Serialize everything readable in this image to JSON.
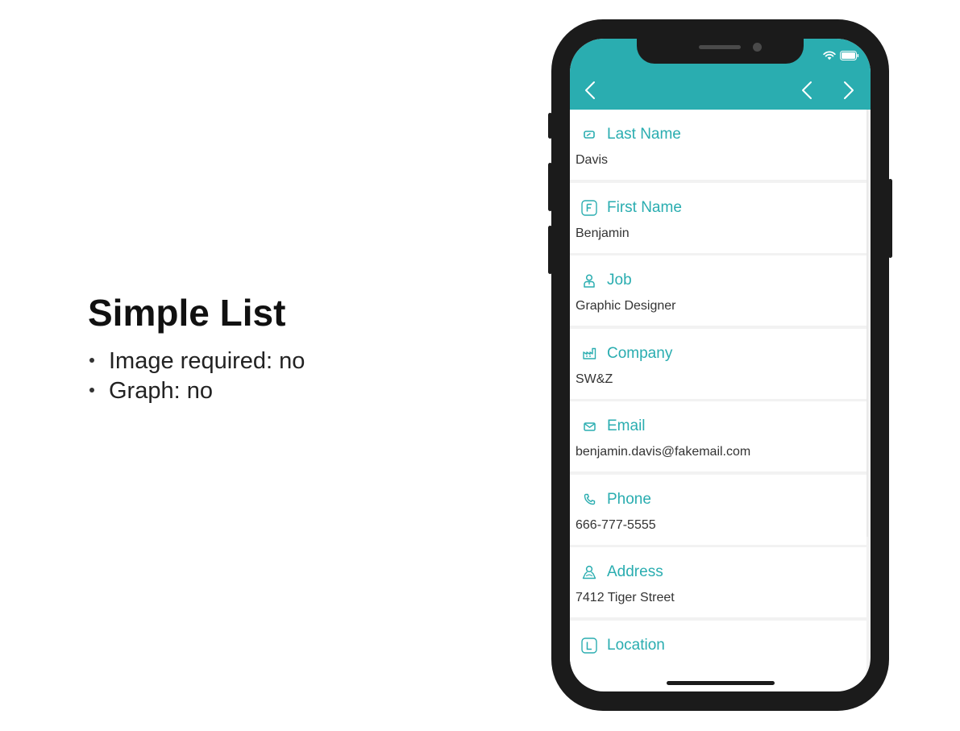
{
  "slide": {
    "title": "Simple List",
    "bullets": [
      "Image required: no",
      "Graph: no"
    ]
  },
  "colors": {
    "accent": "#2aadb0",
    "row_bg": "#ffffff",
    "list_bg": "#f2f2f2",
    "value_text": "#333333",
    "phone_body": "#1b1b1b"
  },
  "header": {
    "back_icon": "chevron-left-icon",
    "prev_icon": "chevron-left-icon",
    "next_icon": "chevron-right-icon"
  },
  "fields": [
    {
      "icon": "id-card-icon",
      "label": "Last Name",
      "value": "Davis"
    },
    {
      "icon": "letter-f-icon",
      "label": "First Name",
      "value": "Benjamin"
    },
    {
      "icon": "person-icon",
      "label": "Job",
      "value": "Graphic Designer"
    },
    {
      "icon": "factory-icon",
      "label": "Company",
      "value": "SW&Z"
    },
    {
      "icon": "envelope-icon",
      "label": "Email",
      "value": "benjamin.davis@fakemail.com"
    },
    {
      "icon": "phone-icon",
      "label": "Phone",
      "value": "666-777-5555"
    },
    {
      "icon": "map-person-icon",
      "label": "Address",
      "value": "7412 Tiger Street"
    },
    {
      "icon": "letter-l-icon",
      "label": "Location",
      "value": ""
    }
  ]
}
